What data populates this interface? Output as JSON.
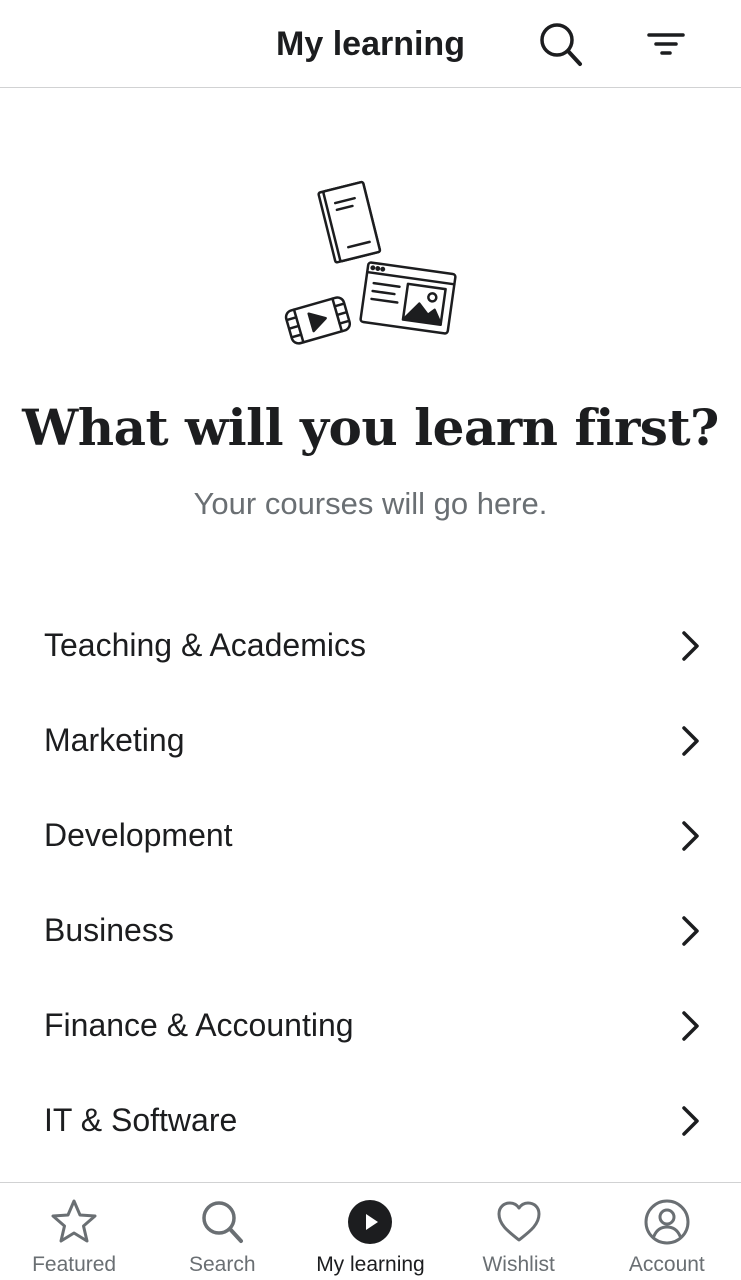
{
  "header": {
    "title": "My learning",
    "search_icon": "search-icon",
    "filter_icon": "filter-icon"
  },
  "empty_state": {
    "illustration": "learning-illustration",
    "title": "What will you learn first?",
    "subtitle": "Your courses will go here."
  },
  "categories": [
    {
      "label": "Teaching & Academics"
    },
    {
      "label": "Marketing"
    },
    {
      "label": "Development"
    },
    {
      "label": "Business"
    },
    {
      "label": "Finance & Accounting"
    },
    {
      "label": "IT & Software"
    }
  ],
  "bottom_nav": {
    "active": "My learning",
    "items": [
      {
        "label": "Featured",
        "icon": "star-icon"
      },
      {
        "label": "Search",
        "icon": "search-icon"
      },
      {
        "label": "My learning",
        "icon": "play-circle-icon"
      },
      {
        "label": "Wishlist",
        "icon": "heart-icon"
      },
      {
        "label": "Account",
        "icon": "user-circle-icon"
      }
    ]
  },
  "colors": {
    "text_primary": "#1c1d1f",
    "text_secondary": "#6a6f73",
    "divider": "#d1d2d3",
    "background": "#ffffff"
  }
}
